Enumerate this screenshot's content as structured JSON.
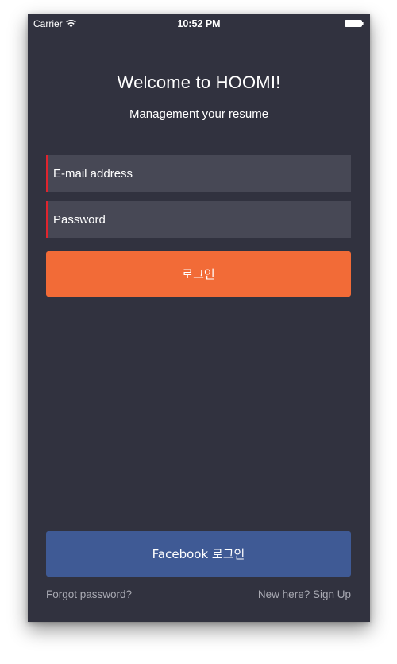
{
  "status_bar": {
    "carrier": "Carrier",
    "time": "10:52 PM",
    "icons": [
      "wifi-icon",
      "battery-icon"
    ]
  },
  "header": {
    "title": "Welcome to HOOMI!",
    "subtitle": "Management your resume"
  },
  "form": {
    "email": {
      "placeholder": "E-mail address",
      "value": ""
    },
    "password": {
      "placeholder": "Password",
      "value": ""
    },
    "login_label": "로그인",
    "facebook_label": "Facebook 로그인"
  },
  "footer": {
    "forgot_label": "Forgot password?",
    "signup_label": "New here? Sign Up"
  },
  "colors": {
    "background": "#31323f",
    "field": "#474855",
    "field_accent": "#e0242e",
    "login_button": "#f26b37",
    "facebook_button": "#3f5a95",
    "muted_text": "#a9aab3"
  }
}
